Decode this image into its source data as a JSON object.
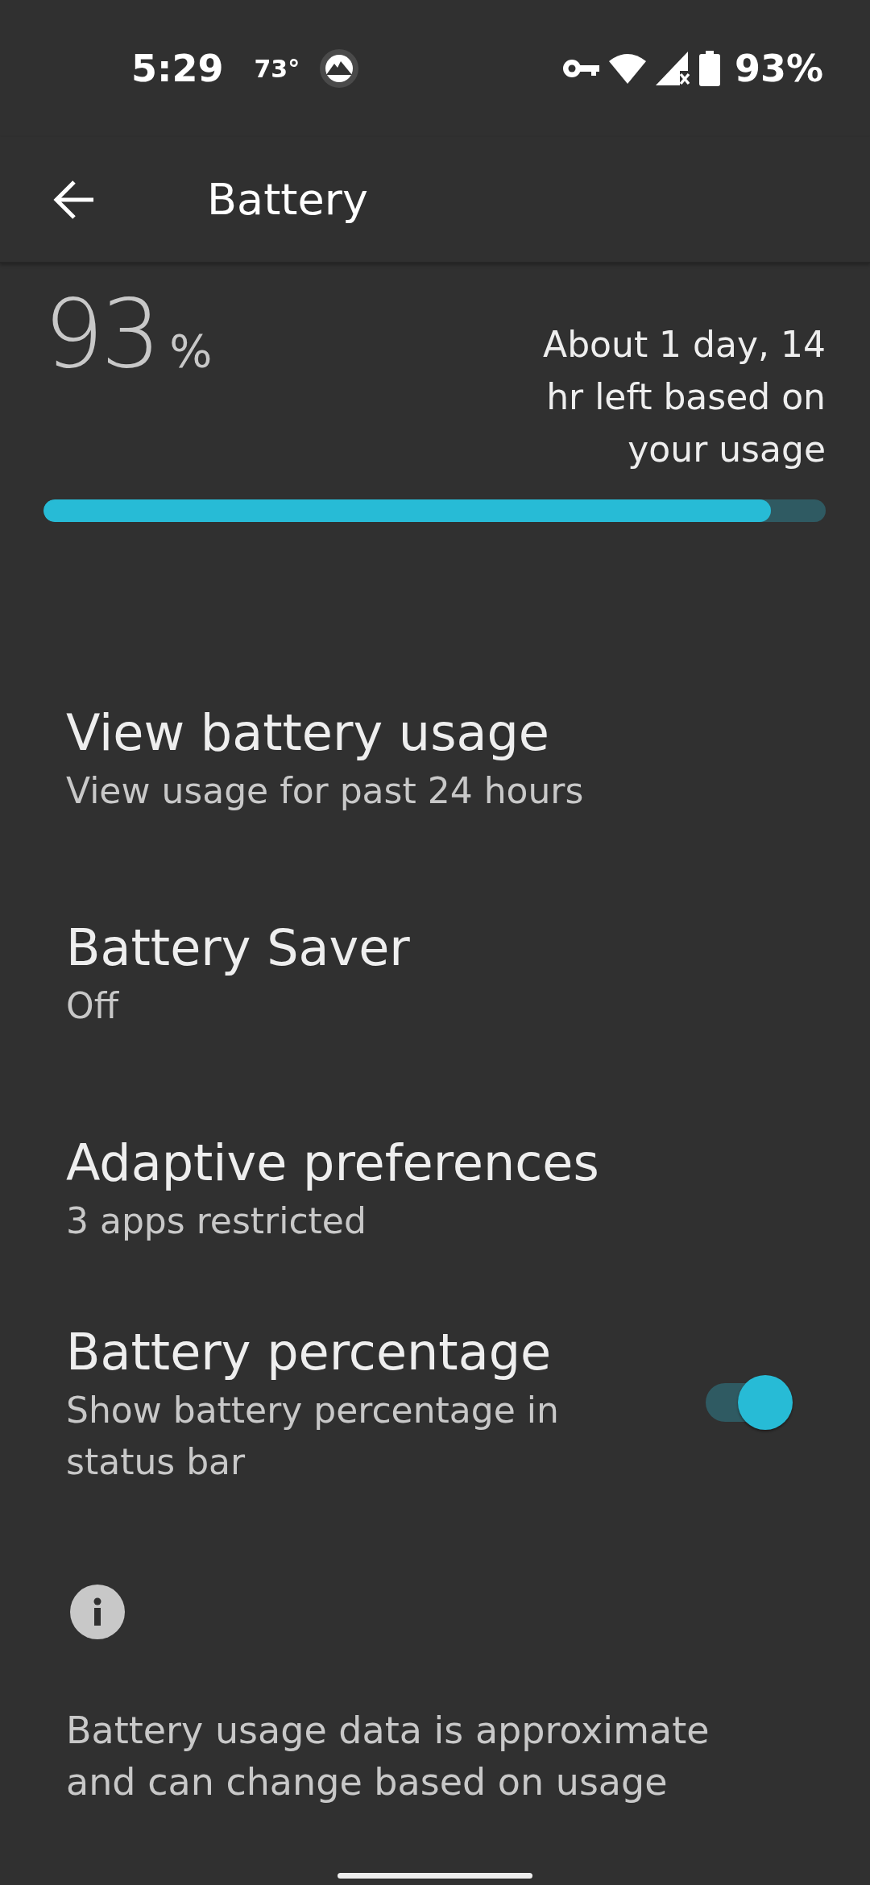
{
  "status_bar": {
    "time": "5:29",
    "temperature": "73°",
    "battery_text": "93%"
  },
  "app_bar": {
    "title": "Battery"
  },
  "battery": {
    "percent": "93",
    "percent_sign": "%",
    "estimate": "About 1 day, 14 hr left based on your usage",
    "level": 0.93
  },
  "items": [
    {
      "kind": "link",
      "title": "View battery usage",
      "subtitle": "View usage for past 24 hours"
    },
    {
      "kind": "link",
      "title": "Battery Saver",
      "subtitle": "Off"
    },
    {
      "kind": "link",
      "title": "Adaptive preferences",
      "subtitle": "3 apps restricted"
    },
    {
      "kind": "switch",
      "title": "Battery percentage",
      "subtitle": "Show battery percentage in status bar",
      "on": true
    }
  ],
  "footer": {
    "text": "Battery usage data is approximate and can change based on usage"
  }
}
